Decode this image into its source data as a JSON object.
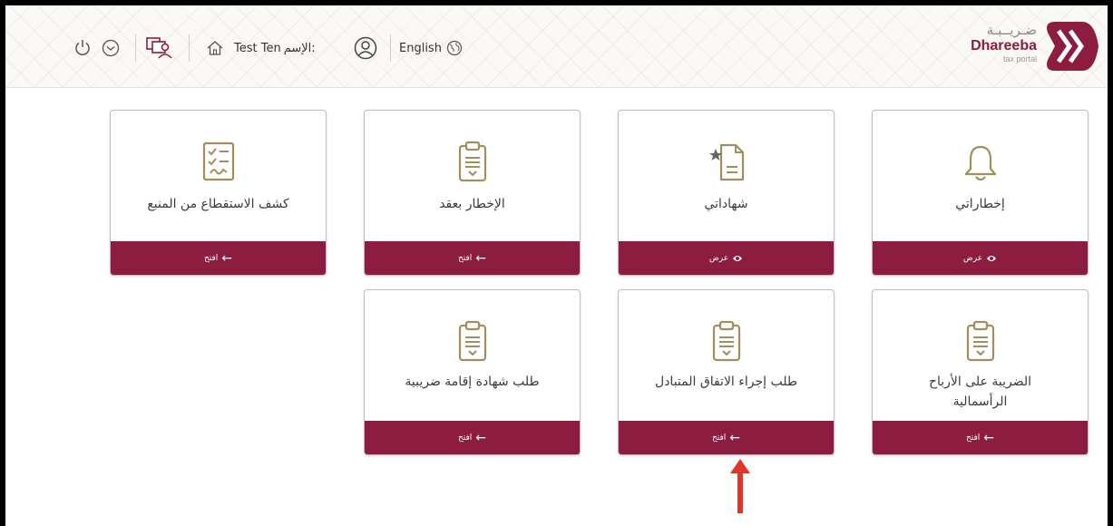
{
  "header": {
    "language_label": "English",
    "user_prefix": "الإسم:",
    "user_name": "Test Ten",
    "logo_ar": "ضـريــبـة",
    "logo_en": "Dhareeba",
    "logo_sub": "tax portal"
  },
  "cards": [
    {
      "title": "إخطاراتي",
      "button": "عرض",
      "icon": "bell-icon"
    },
    {
      "title": "شهاداتي",
      "button": "عرض",
      "icon": "certificate-icon"
    },
    {
      "title": "الإخطار بعقد",
      "button": "افتح",
      "icon": "clipboard-icon"
    },
    {
      "title": "كشف الاستقطاع من المنبع",
      "button": "افتح",
      "icon": "checklist-icon"
    },
    {
      "title": "الضريبة على الأرباح الرأسمالية",
      "button": "افتح",
      "icon": "clipboard-icon"
    },
    {
      "title": "طلب إجراء الاتفاق المتبادل",
      "button": "افتح",
      "icon": "clipboard-icon"
    },
    {
      "title": "طلب شهادة إقامة ضريبية",
      "button": "افتح",
      "icon": "clipboard-icon"
    }
  ],
  "colors": {
    "brand": "#8c1d40",
    "icon_gold": "#a48d5d"
  }
}
